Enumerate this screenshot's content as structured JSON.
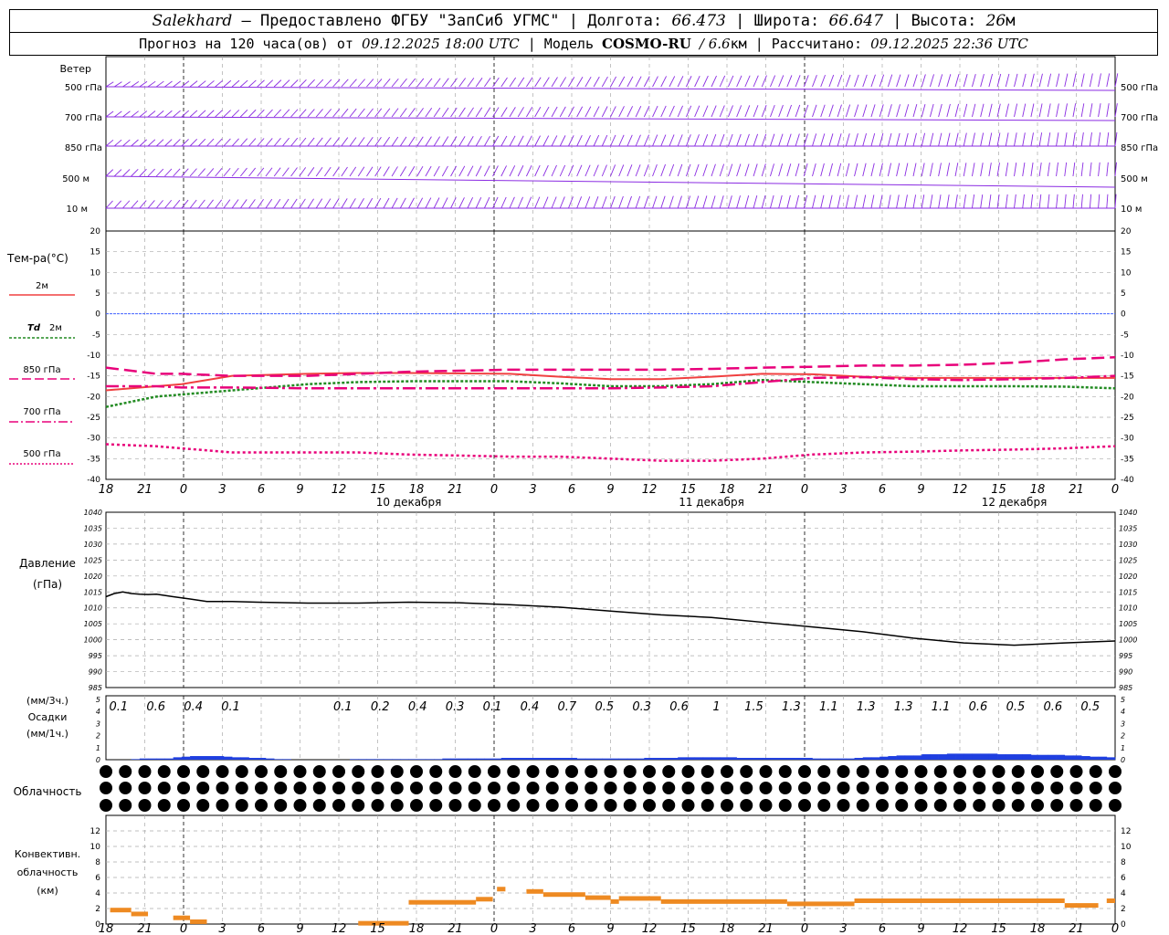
{
  "header": {
    "station": "Salekhard",
    "provider": "– Предоставлено ФГБУ \"ЗапСиб УГМС\" |",
    "lon_label": "Долгота:",
    "lon": "66.473",
    "lat_label": "| Широта:",
    "lat": "66.647",
    "alt_label": "| Высота:",
    "alt": "26",
    "alt_unit": "м",
    "forecast_label": "Прогноз на 120 часа(ов) от",
    "forecast_from": "09.12.2025 18:00 UTC",
    "model_label": "| Модель",
    "model": "COSMO-RU",
    "resolution": "/ 6.6",
    "res_unit": "км",
    "calc_label": "| Рассчитано:",
    "calc_time": "09.12.2025 22:36 UTC"
  },
  "labels": {
    "wind": "Ветер",
    "wind_levels": [
      "500 гПа",
      "700 гПа",
      "850 гПа",
      "500 м",
      "10 м"
    ],
    "temp": "Тем-ра(°C)",
    "t2m": "2м",
    "td_sym": "Td",
    "td_level": "2м",
    "t850": "850 гПа",
    "t700": "700 гПа",
    "t500": "500 гПа",
    "pressure": "Давление",
    "pressure_unit": "(гПа)",
    "precip_3h": "(мм/3ч.)",
    "precip": "Осадки",
    "precip_1h": "(мм/1ч.)",
    "cloud": "Облачность",
    "conv1": "Конвективн.",
    "conv2": "облачность",
    "conv_unit": "(км)"
  },
  "chart_data": {
    "type": "line",
    "x_ticks": [
      "18",
      "21",
      "0",
      "3",
      "6",
      "9",
      "12",
      "15",
      "18",
      "21",
      "0",
      "3",
      "6",
      "9",
      "12",
      "15",
      "18",
      "21",
      "0",
      "3",
      "6",
      "9",
      "12",
      "15",
      "18",
      "21",
      "0"
    ],
    "days": [
      "10 декабря",
      "11 декабря",
      "12 декабря"
    ],
    "temperature": {
      "ylim": [
        -40,
        20
      ],
      "yticks": [
        20,
        15,
        10,
        5,
        0,
        -5,
        -10,
        -15,
        -20,
        -25,
        -30,
        -35,
        -40
      ],
      "hours": [
        0,
        6,
        9,
        15,
        24,
        30,
        36,
        48,
        54,
        60,
        66,
        72,
        78,
        84,
        90,
        96,
        102,
        108,
        114,
        120
      ],
      "series": [
        {
          "name": "2м",
          "color": "#f04040",
          "values": [
            -18.5,
            -17.5,
            -17,
            -15,
            -14.5,
            -14.3,
            -14.3,
            -14.5,
            -15.2,
            -15.8,
            -15.8,
            -15.2,
            -14.5,
            -14.6,
            -15.2,
            -15.5,
            -15.5,
            -15.5,
            -15.5,
            -15.5
          ]
        },
        {
          "name": "Td 2м",
          "color": "#228b22",
          "values": [
            -22.5,
            -20,
            -19.5,
            -18.5,
            -17,
            -16.5,
            -16.3,
            -16.3,
            -16.8,
            -17.5,
            -17.5,
            -17,
            -16,
            -16.5,
            -17,
            -17.5,
            -17.5,
            -17.5,
            -17.6,
            -18
          ]
        },
        {
          "name": "850 гПа",
          "color": "#e8007a",
          "values": [
            -13,
            -14.5,
            -14.5,
            -15,
            -15,
            -14.5,
            -14,
            -13.5,
            -13.5,
            -13.5,
            -13.5,
            -13.3,
            -13,
            -12.8,
            -12.5,
            -12.5,
            -12.3,
            -11.8,
            -11,
            -10.5
          ]
        },
        {
          "name": "700 гПа",
          "color": "#e8007a",
          "values": [
            -17.5,
            -17.5,
            -17.8,
            -17.8,
            -18,
            -18,
            -18,
            -18,
            -18,
            -18,
            -17.8,
            -17.5,
            -16.5,
            -15.5,
            -15.3,
            -15.8,
            -16,
            -15.8,
            -15.5,
            -15
          ]
        },
        {
          "name": "500 гПа",
          "color": "#e8007a",
          "values": [
            -31.5,
            -32,
            -32.5,
            -33.5,
            -33.5,
            -33.5,
            -34,
            -34.5,
            -34.5,
            -35,
            -35.5,
            -35.5,
            -35,
            -34,
            -33.5,
            -33.3,
            -33,
            -32.8,
            -32.5,
            -32
          ]
        }
      ]
    },
    "pressure": {
      "ylim": [
        985,
        1040
      ],
      "yticks": [
        1040,
        1035,
        1030,
        1025,
        1020,
        1015,
        1010,
        1005,
        1000,
        995,
        990,
        985
      ],
      "hours": [
        0,
        1,
        2,
        3,
        4,
        5,
        6,
        8,
        10,
        12,
        15,
        18,
        24,
        30,
        36,
        42,
        48,
        54,
        60,
        66,
        72,
        78,
        84,
        90,
        96,
        102,
        108,
        114,
        120
      ],
      "values": [
        1013.5,
        1014.5,
        1015,
        1014.5,
        1014.3,
        1014.2,
        1014.3,
        1013.5,
        1012.8,
        1012,
        1012,
        1011.8,
        1011.5,
        1011.5,
        1011.8,
        1011.6,
        1011,
        1010.2,
        1009,
        1007.8,
        1007,
        1005.5,
        1004,
        1002.5,
        1000.5,
        999,
        998.3,
        999,
        999.6
      ]
    },
    "precipitation": {
      "ylim": [
        0,
        5
      ],
      "yticks": [
        5,
        4,
        3,
        2,
        1,
        0
      ],
      "totals_3h": [
        "0.1",
        "0.6",
        "0.4",
        "0.1",
        "",
        "",
        "0.1",
        "0.2",
        "0.4",
        "0.3",
        "0.1",
        "0.4",
        "0.7",
        "0.5",
        "0.3",
        "0.6",
        "1",
        "1.5",
        "1.3",
        "1.1",
        "1.3",
        "1.3",
        "1.1",
        "0.6",
        "0.5",
        "0.6",
        "0.5"
      ],
      "hourly_mm": [
        0,
        0,
        0,
        0.05,
        0.1,
        0.1,
        0.1,
        0.1,
        0.2,
        0.25,
        0.3,
        0.3,
        0.3,
        0.3,
        0.25,
        0.2,
        0.2,
        0.15,
        0.15,
        0.1,
        0.05,
        0.05,
        0,
        0,
        0,
        0,
        0,
        0,
        0,
        0.05,
        0.05,
        0.05,
        0.05,
        0.05,
        0.05,
        0.05,
        0.05,
        0.05,
        0.05,
        0.05,
        0.1,
        0.1,
        0.1,
        0.1,
        0.1,
        0.1,
        0.1,
        0.15,
        0.15,
        0.15,
        0.15,
        0.15,
        0.15,
        0.15,
        0.15,
        0.15,
        0.1,
        0.1,
        0.1,
        0.1,
        0.1,
        0.1,
        0.1,
        0.1,
        0.15,
        0.15,
        0.15,
        0.15,
        0.2,
        0.2,
        0.2,
        0.2,
        0.2,
        0.2,
        0.2,
        0.15,
        0.15,
        0.15,
        0.15,
        0.15,
        0.15,
        0.15,
        0.15,
        0.15,
        0.1,
        0.1,
        0.1,
        0.1,
        0.1,
        0.15,
        0.2,
        0.2,
        0.25,
        0.3,
        0.35,
        0.35,
        0.35,
        0.45,
        0.45,
        0.45,
        0.5,
        0.5,
        0.5,
        0.5,
        0.5,
        0.5,
        0.45,
        0.45,
        0.45,
        0.45,
        0.4,
        0.4,
        0.4,
        0.4,
        0.35,
        0.35,
        0.3,
        0.25,
        0.25,
        0.2
      ]
    },
    "convective_cloud": {
      "ylim": [
        0,
        14
      ],
      "yticks": [
        12,
        10,
        8,
        6,
        4,
        2,
        0
      ],
      "segments": [
        {
          "h0": 0.5,
          "h1": 3,
          "km": 1.8
        },
        {
          "h0": 3,
          "h1": 5,
          "km": 1.3
        },
        {
          "h0": 8,
          "h1": 10,
          "km": 0.8
        },
        {
          "h0": 10,
          "h1": 12,
          "km": 0.3
        },
        {
          "h0": 30,
          "h1": 36,
          "km": 0.1
        },
        {
          "h0": 36,
          "h1": 44,
          "km": 2.8
        },
        {
          "h0": 44,
          "h1": 46,
          "km": 3.2
        },
        {
          "h0": 46.5,
          "h1": 47.5,
          "km": 4.5
        },
        {
          "h0": 50,
          "h1": 52,
          "km": 4.2
        },
        {
          "h0": 52,
          "h1": 57,
          "km": 3.8
        },
        {
          "h0": 57,
          "h1": 60,
          "km": 3.4
        },
        {
          "h0": 60,
          "h1": 61,
          "km": 2.9
        },
        {
          "h0": 61,
          "h1": 66,
          "km": 3.3
        },
        {
          "h0": 66,
          "h1": 81,
          "km": 2.9
        },
        {
          "h0": 81,
          "h1": 89,
          "km": 2.6
        },
        {
          "h0": 89,
          "h1": 114,
          "km": 3.0
        },
        {
          "h0": 114,
          "h1": 118,
          "km": 2.4
        },
        {
          "h0": 119,
          "h1": 120,
          "km": 3.0
        }
      ]
    }
  },
  "colors": {
    "wind": "#8a2be2",
    "precip": "#1f3fe0",
    "conv": "#ee8a22",
    "grid": "#aaaaaa",
    "zero_line": "#4060ff"
  }
}
